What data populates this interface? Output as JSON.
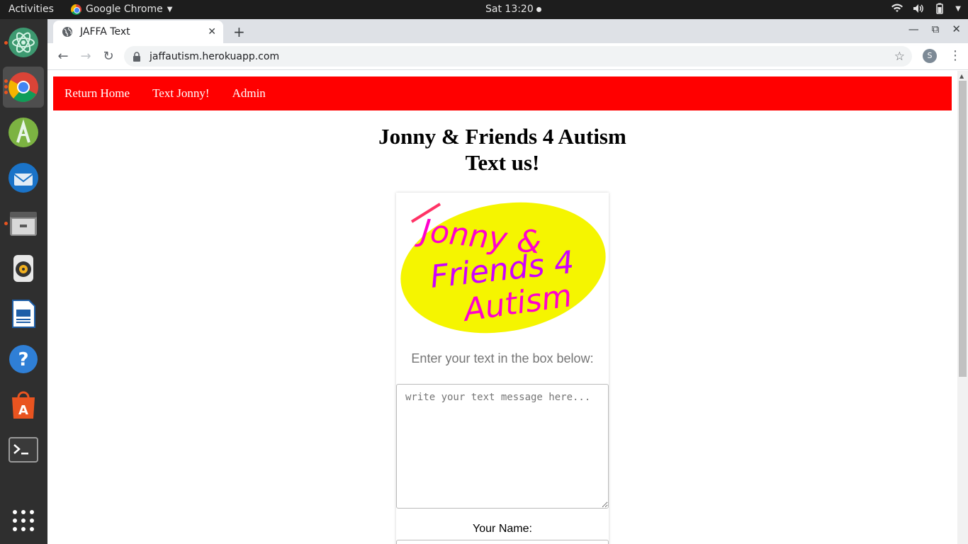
{
  "topbar": {
    "activities": "Activities",
    "app_name": "Google Chrome",
    "clock": "Sat 13:20"
  },
  "dock": {
    "apps": [
      "atom-icon",
      "chrome-icon",
      "android-studio-icon",
      "thunderbird-icon",
      "files-icon",
      "rhythmbox-icon",
      "writer-icon",
      "help-icon",
      "software-icon",
      "terminal-icon",
      "apps-grid-icon"
    ]
  },
  "browser": {
    "tab_title": "JAFFA Text",
    "url": "jaffautism.herokuapp.com",
    "profile_initial": "S"
  },
  "nav": {
    "items": [
      "Return Home",
      "Text Jonny!",
      "Admin"
    ]
  },
  "page": {
    "title_line1": "Jonny & Friends 4 Autism",
    "title_line2": "Text us!",
    "logo_lines": [
      "Jonny &",
      "Friends 4",
      "Autism"
    ],
    "prompt": "Enter your text in the box below:",
    "message_placeholder": "write your text message here...",
    "name_label": "Your Name:"
  },
  "colors": {
    "nav_bg": "#ff0000",
    "logo_ellipse": "#f5f500",
    "logo_text": "#ff00cc",
    "accent": "#e95420"
  }
}
